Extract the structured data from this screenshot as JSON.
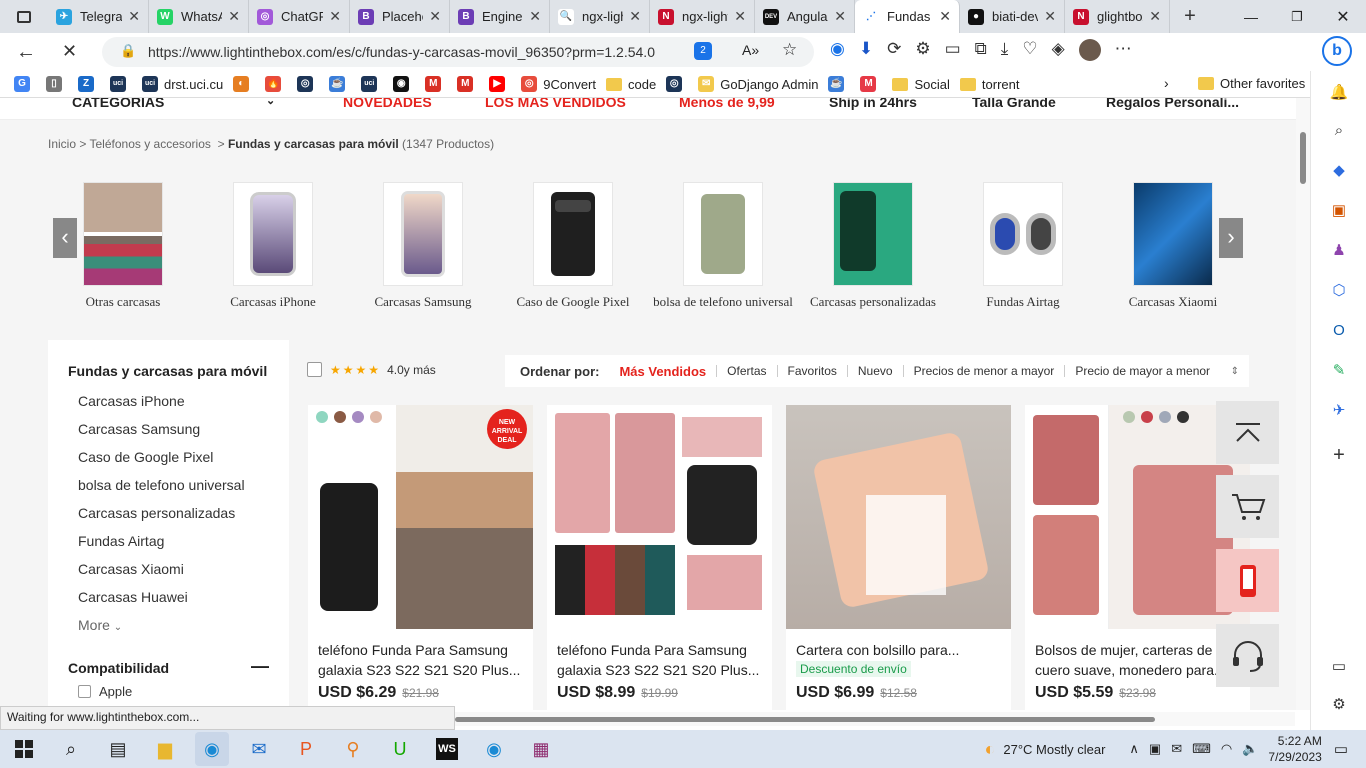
{
  "browser": {
    "tabs": [
      {
        "label": "Telegram",
        "color": "#2aa3df",
        "glyph": "✈"
      },
      {
        "label": "WhatsApp",
        "color": "#25d366",
        "glyph": "W"
      },
      {
        "label": "ChatGPT",
        "color": "#a259d9",
        "glyph": "◎"
      },
      {
        "label": "Placeholder",
        "color": "#6c3db5",
        "glyph": "B"
      },
      {
        "label": "Engine",
        "color": "#6c3db5",
        "glyph": "B"
      },
      {
        "label": "ngx-lightbox",
        "color": "#ffffff",
        "glyph": "🔍"
      },
      {
        "label": "ngx-lightbox",
        "color": "#c8102e",
        "glyph": "N"
      },
      {
        "label": "Angular",
        "color": "#111111",
        "glyph": "DEV"
      },
      {
        "label": "Fundas y carcasas",
        "color": "#ffffff",
        "glyph": "⋰"
      },
      {
        "label": "biati-dev",
        "color": "#111111",
        "glyph": "●"
      },
      {
        "label": "glightbox",
        "color": "#c8102e",
        "glyph": "N"
      }
    ],
    "url": "https://www.lightinthebox.com/es/c/fundas-y-carcasas-movil_96350?prm=1.2.54.0",
    "notification_count": "2",
    "bookmarks": [
      {
        "label": "",
        "type": "g"
      },
      {
        "label": "",
        "type": "doc"
      },
      {
        "label": "",
        "type": "z"
      },
      {
        "label": "",
        "type": "uci"
      },
      {
        "label": "drst.uci.cu",
        "type": "uci2"
      },
      {
        "label": "",
        "type": "ball"
      },
      {
        "label": "",
        "type": "fire"
      },
      {
        "label": "",
        "type": "ghost"
      },
      {
        "label": "",
        "type": "cup"
      },
      {
        "label": "",
        "type": "uci3"
      },
      {
        "label": "",
        "type": "gh"
      },
      {
        "label": "",
        "type": "gm"
      },
      {
        "label": "",
        "type": "gm2"
      },
      {
        "label": "",
        "type": "yt"
      },
      {
        "label": "9Convert",
        "type": "pin"
      },
      {
        "label": "code",
        "type": "folder"
      },
      {
        "label": "",
        "type": "ghost2"
      },
      {
        "label": "GoDjango Admin",
        "type": "mail"
      },
      {
        "label": "",
        "type": "cup2"
      },
      {
        "label": "",
        "type": "m"
      },
      {
        "label": "Social",
        "type": "folder"
      },
      {
        "label": "torrent",
        "type": "folder"
      }
    ],
    "other_favorites": "Other favorites",
    "status_text": "Waiting for www.lightinthebox.com..."
  },
  "site": {
    "topnav": [
      "CATEGORÍAS",
      "NOVEDADES",
      "LOS MÁS VENDIDOS",
      "Menos de 9,99",
      "Ship in 24hrs",
      "Talla Grande",
      "Regalos Personali..."
    ],
    "breadcrumb": {
      "home": "Inicio",
      "sep": ">",
      "level1": "Teléfonos y accesorios",
      "current": "Fundas y carcasas para móvil",
      "count": "(1347 Productos)"
    },
    "categories": [
      {
        "label": "Otras carcasas"
      },
      {
        "label": "Carcasas iPhone"
      },
      {
        "label": "Carcasas Samsung"
      },
      {
        "label": "Caso de Google Pixel"
      },
      {
        "label": "bolsa de telefono universal"
      },
      {
        "label": "Carcasas personalizadas"
      },
      {
        "label": "Fundas Airtag"
      },
      {
        "label": "Carcasas Xiaomi"
      }
    ],
    "sidebar": {
      "title": "Fundas y carcasas para móvil",
      "items": [
        "Carcasas iPhone",
        "Carcasas Samsung",
        "Caso de Google Pixel",
        "bolsa de telefono universal",
        "Carcasas personalizadas",
        "Fundas Airtag",
        "Carcasas Xiaomi",
        "Carcasas Huawei"
      ],
      "more": "More",
      "section2": "Compatibilidad",
      "section2_first": "Apple"
    },
    "rating_filter": "4.0y más",
    "sort": {
      "label": "Ordenar por:",
      "options": [
        "Más Vendidos",
        "Ofertas",
        "Favoritos",
        "Nuevo",
        "Precios de menor a mayor",
        "Precio de mayor a menor"
      ],
      "active": "Más Vendidos"
    },
    "products": [
      {
        "title": "teléfono Funda Para Samsung galaxia S23 S22 S21 S20 Plus...",
        "price": "USD $6.29",
        "old": "$21.98",
        "badge": "NEW ARRIVAL DEAL",
        "ship": ""
      },
      {
        "title": "teléfono Funda Para Samsung galaxia S23 S22 S21 S20 Plus...",
        "price": "USD $8.99",
        "old": "$19.99",
        "badge": "",
        "ship": ""
      },
      {
        "title": "Cartera con bolsillo para...",
        "price": "USD $6.99",
        "old": "$12.58",
        "badge": "",
        "ship": "Descuento de envío"
      },
      {
        "title": "Bolsos de mujer, carteras de cuero suave, monedero para...",
        "price": "USD $5.59",
        "old": "$23.98",
        "badge": "",
        "ship": ""
      }
    ]
  },
  "taskbar": {
    "weather": "27°C  Mostly clear",
    "time": "5:22 AM",
    "date": "7/29/2023"
  },
  "colors": {
    "accent_red": "#e4231d",
    "sort_active": "#e4231d"
  }
}
